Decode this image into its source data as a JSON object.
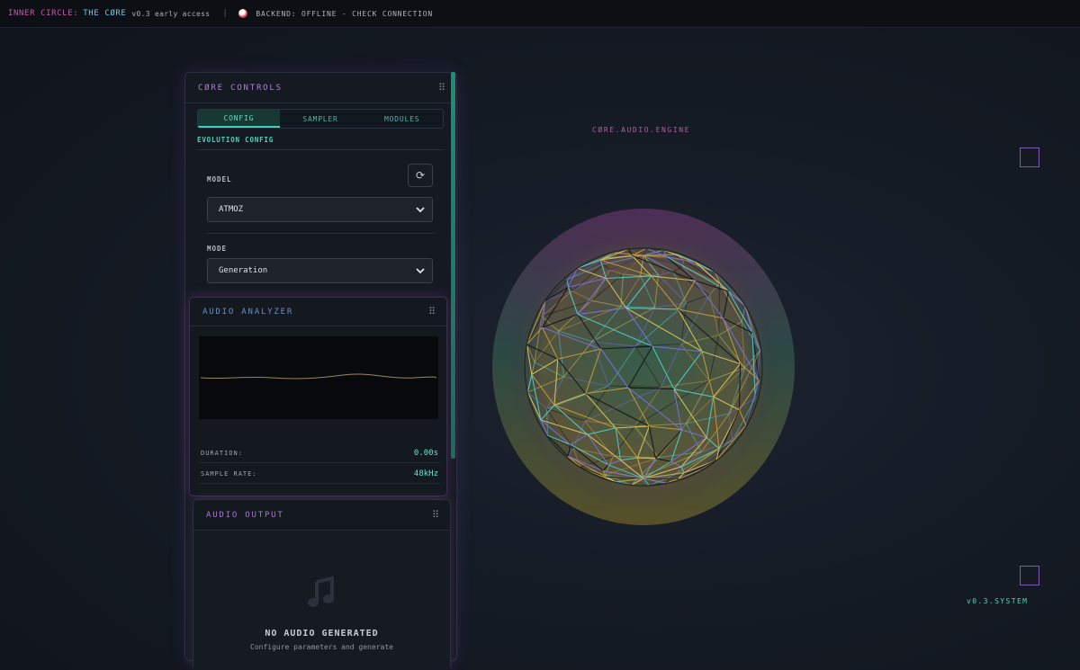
{
  "topbar": {
    "brand_a": "INNER CIRCLE:",
    "brand_b": "THE CØRE",
    "version": "v0.3 early access",
    "separator": "|",
    "status_color": "#e0484b",
    "backend_status": "BACKEND: OFFLINE - CHECK CONNECTION"
  },
  "controls": {
    "title": "CØRE CONTROLS",
    "grip_icon": "⠿",
    "tabs": [
      {
        "label": "CONFIG",
        "active": true
      },
      {
        "label": "SAMPLER",
        "active": false
      },
      {
        "label": "MODULES",
        "active": false
      }
    ],
    "section_title": "EVOLUTION CONFIG",
    "model": {
      "label": "MODEL",
      "value": "ATMOZ",
      "refresh_icon": "⟳"
    },
    "mode": {
      "label": "MODE",
      "value": "Generation"
    }
  },
  "analyzer": {
    "title": "AUDIO ANALYZER",
    "grip_icon": "⠿",
    "duration_label": "DURATION:",
    "duration_value": "0.00s",
    "sample_rate_label": "SAMPLE RATE:",
    "sample_rate_value": "48kHz"
  },
  "output": {
    "title": "AUDIO OUTPUT",
    "grip_icon": "⠿",
    "empty_title": "NO AUDIO GENERATED",
    "empty_hint": "Configure parameters and generate"
  },
  "visualizer": {
    "engine_label": "CØRE.AUDIO.ENGINE",
    "system_label": "v0.3.SYSTEM"
  },
  "colors": {
    "accent_teal": "#3fd1b2",
    "accent_purple": "#b07ed8",
    "accent_pink": "#c05aa8"
  }
}
